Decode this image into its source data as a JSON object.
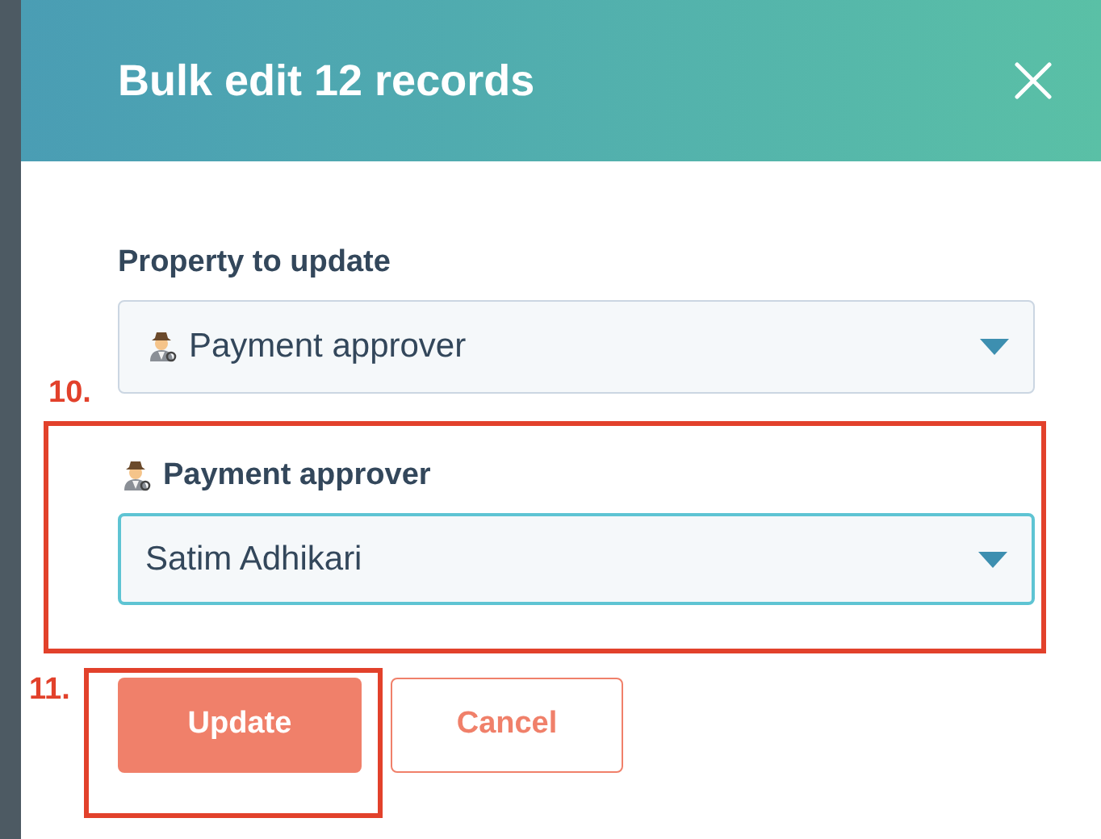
{
  "dialog": {
    "title": "Bulk edit 12 records"
  },
  "fields": [
    {
      "label": "Property to update",
      "label_icon": false,
      "value": "Payment approver",
      "value_icon": true,
      "focused": false
    },
    {
      "label": "Payment approver",
      "label_icon": true,
      "value": "Satim Adhikari",
      "value_icon": false,
      "focused": true
    }
  ],
  "buttons": [
    {
      "label": "Update",
      "kind": "primary"
    },
    {
      "label": "Cancel",
      "kind": "secondary"
    }
  ],
  "annotations": [
    {
      "label": "10."
    },
    {
      "label": "11."
    }
  ]
}
